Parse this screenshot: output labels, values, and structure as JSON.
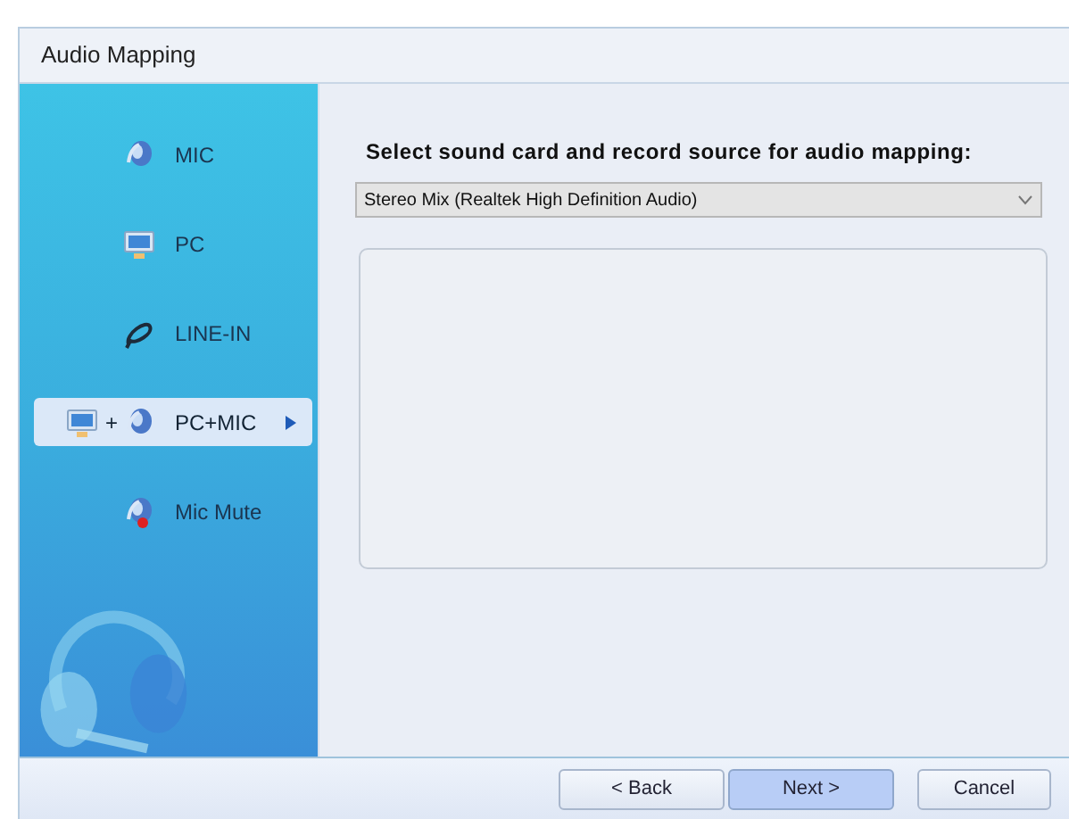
{
  "window": {
    "title": "Audio Mapping"
  },
  "sidebar": {
    "items": [
      {
        "label": "MIC",
        "kind": "mic",
        "selected": false
      },
      {
        "label": "PC",
        "kind": "pc",
        "selected": false
      },
      {
        "label": "LINE-IN",
        "kind": "line",
        "selected": false
      },
      {
        "label": "PC+MIC",
        "kind": "pcmic",
        "icon_joiner": "+",
        "selected": true
      },
      {
        "label": "Mic Mute",
        "kind": "mute",
        "selected": false
      }
    ]
  },
  "main": {
    "heading": "Select sound card and record source for audio mapping:",
    "source_select": {
      "value": "Stereo Mix (Realtek High Definition Audio)"
    }
  },
  "buttons": [
    {
      "label": "< Back",
      "highlighted": false
    },
    {
      "label": "Next >",
      "highlighted": true
    },
    {
      "label": "Cancel",
      "highlighted": false
    }
  ]
}
